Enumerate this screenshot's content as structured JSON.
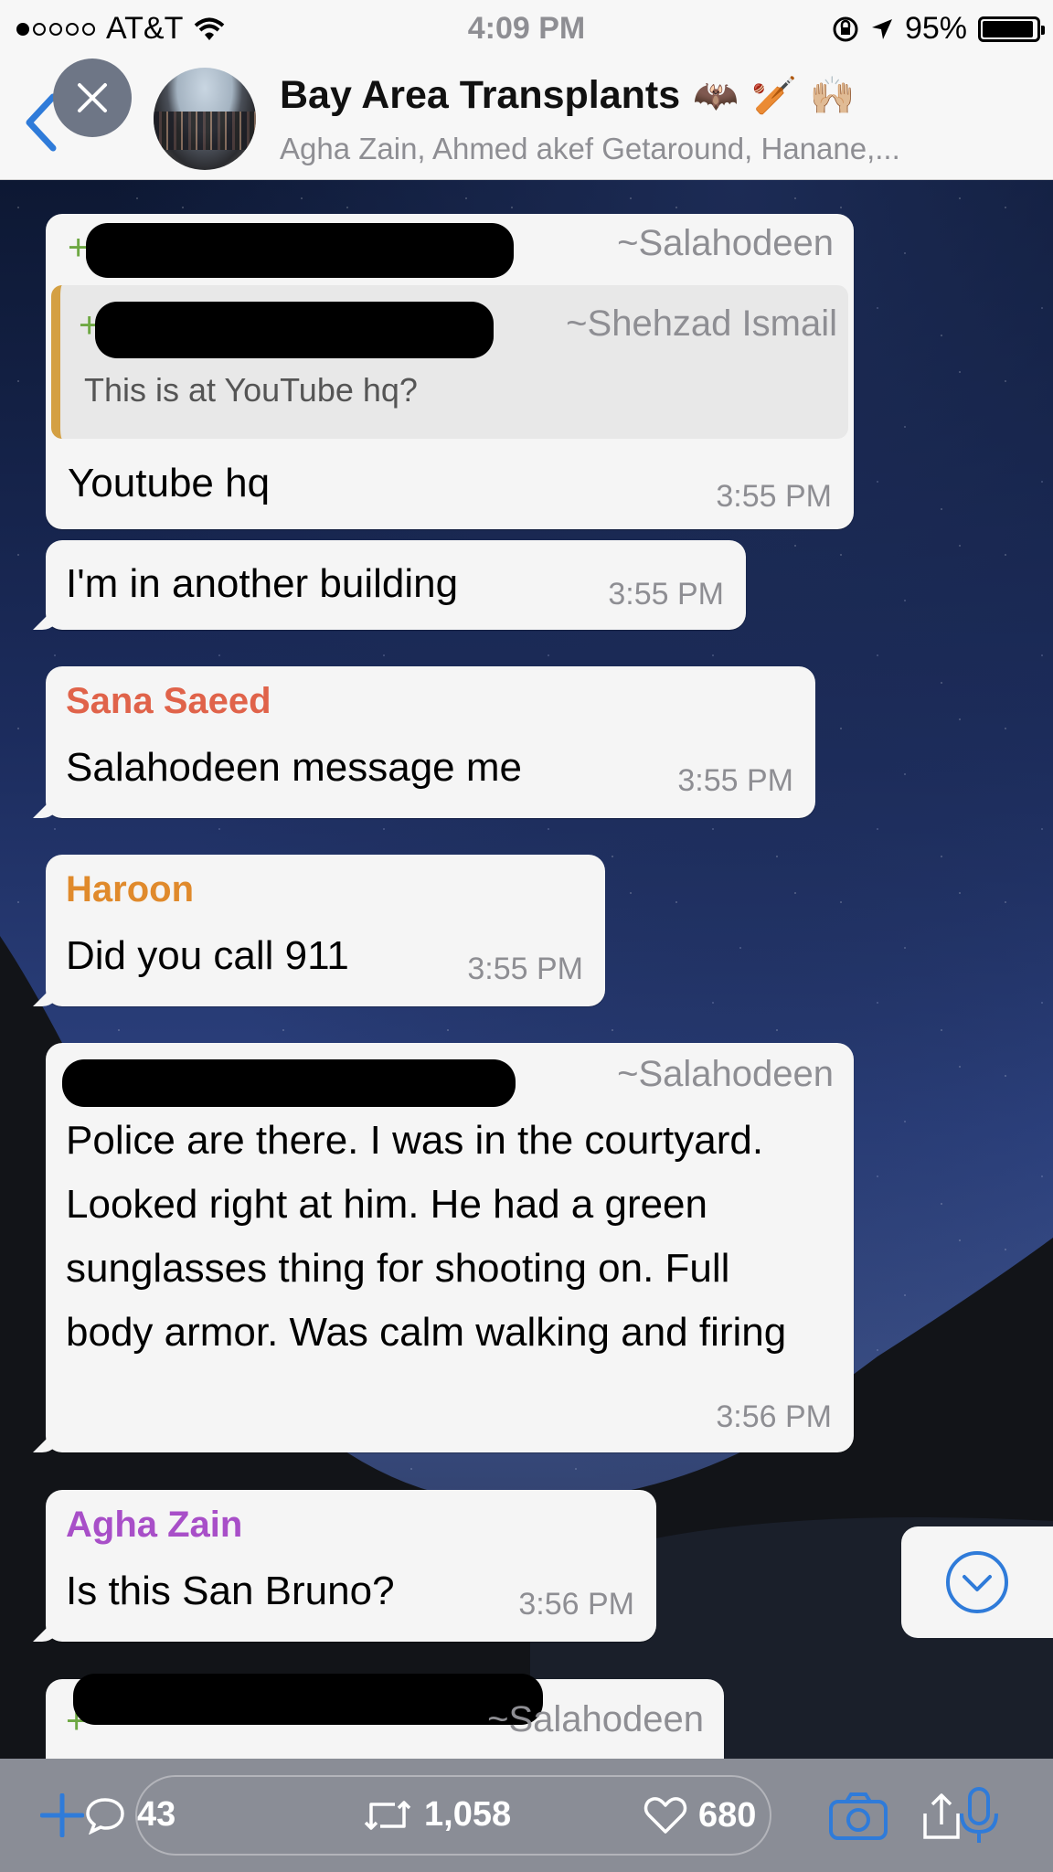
{
  "status_bar": {
    "carrier": "AT&T",
    "time": "4:09 PM",
    "battery": "95%",
    "battery_level": 0.95,
    "signal_bars": 1
  },
  "header": {
    "title": "Bay Area Transplants",
    "title_emojis": [
      "🦇",
      "🏏",
      "🙌🏼"
    ],
    "subtitle": "Agha Zain, Ahmed akef Getaround, Hanane,..."
  },
  "messages": {
    "m1": {
      "sender_tilde": "~Salahodeen",
      "quote_sender": "~Shehzad Ismail",
      "quote_text": "This is at YouTube hq?",
      "plus_prefix": "+",
      "text": "Youtube hq",
      "time": "3:55 PM"
    },
    "m2": {
      "text": "I'm in another building",
      "time": "3:55 PM"
    },
    "m3": {
      "sender": "Sana Saeed",
      "text": "Salahodeen message me",
      "time": "3:55 PM"
    },
    "m4": {
      "sender": "Haroon",
      "text": "Did you call 911",
      "time": "3:55 PM"
    },
    "m5": {
      "sender_tilde": "~Salahodeen",
      "text": "Police are there. I was in the courtyard. Looked right at him. He had a green sunglasses thing for shooting on. Full body armor. Was calm walking and firing",
      "time": "3:56 PM"
    },
    "m6": {
      "sender": "Agha Zain",
      "text": "Is this San Bruno?",
      "time": "3:56 PM"
    },
    "m7": {
      "sender_tilde": "~Salahodeen"
    }
  },
  "bottom_bar": {
    "replies": "43",
    "retweets": "1,058",
    "likes": "680"
  },
  "colors": {
    "sana": "#e0634a",
    "haroon": "#e08a2c",
    "agha": "#a84fc8",
    "ios_blue": "#2f7bd9",
    "quote_bar": "#d4a043"
  },
  "icons": [
    "back-chevron-icon",
    "close-icon",
    "wifi-icon",
    "lock-rotation-icon",
    "location-arrow-icon",
    "chevron-down-icon",
    "plus-icon",
    "reply-icon",
    "retweet-icon",
    "heart-icon",
    "camera-icon",
    "share-icon",
    "microphone-icon"
  ]
}
